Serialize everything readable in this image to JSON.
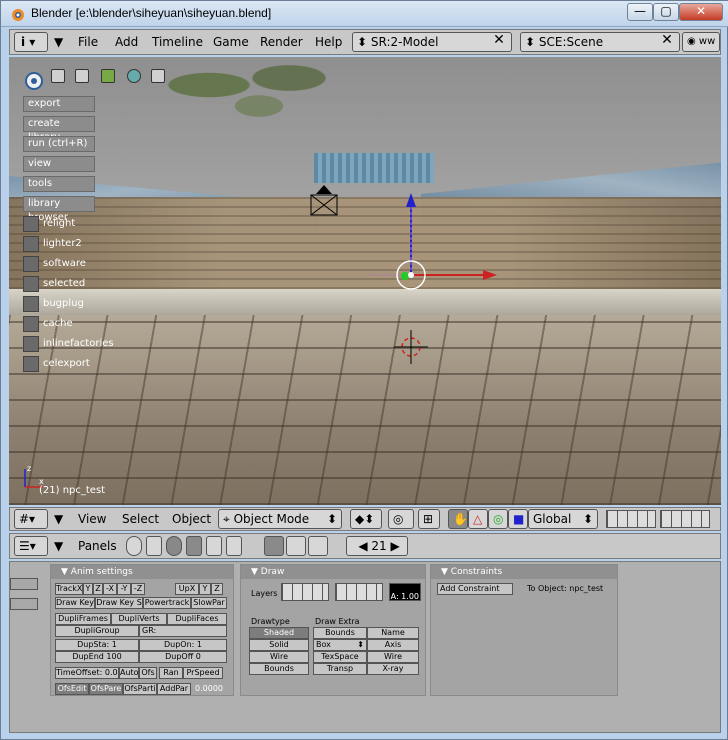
{
  "window": {
    "title": "Blender [e:\\blender\\siheyuan\\siheyuan.blend]"
  },
  "menubar": {
    "items": [
      "File",
      "Add",
      "Timeline",
      "Game",
      "Render",
      "Help"
    ],
    "screen": "SR:2-Model",
    "scene": "SCE:Scene",
    "extra": "ww"
  },
  "script_buttons": [
    "export",
    "create library",
    "run (ctrl+R)",
    "view",
    "tools",
    "library browser"
  ],
  "script_toggles": [
    "relight",
    "lighter2",
    "software",
    "selected",
    "bugplug",
    "cache",
    "inlinefactories",
    "celexport"
  ],
  "viewport": {
    "object_label": "(21) npc_test"
  },
  "view_header": {
    "menus": [
      "View",
      "Select",
      "Object"
    ],
    "mode": "Object Mode",
    "orientation": "Global"
  },
  "buttons_header": {
    "panels_label": "Panels",
    "frame": "21"
  },
  "anim_panel": {
    "title": "Anim settings",
    "row1": [
      "TrackX",
      "Y",
      "Z",
      "-X",
      "-Y",
      "-Z",
      "UpX",
      "Y",
      "Z"
    ],
    "row2": [
      "Draw Key",
      "Draw Key S",
      "Powertrack",
      "SlowPar"
    ],
    "row3": [
      "DupliFrames",
      "DupliVerts",
      "DupliFaces"
    ],
    "row4": [
      "DupliGroup",
      "GR:"
    ],
    "row5": [
      "DupSta: 1",
      "DupOn: 1"
    ],
    "row6": [
      "DupEnd 100",
      "DupOff 0"
    ],
    "row7": [
      "TimeOffset: 0.00",
      "Auto",
      "Ofs",
      "Ran",
      "PrSpeed"
    ],
    "row8": [
      "OfsEdit",
      "OfsPare",
      "OfsParti",
      "AddPar"
    ],
    "value": "0.0000"
  },
  "draw_panel": {
    "title": "Draw",
    "layers_label": "Layers",
    "alpha": "A: 1.00",
    "drawtype_label": "Drawtype",
    "drawextra_label": "Draw Extra",
    "drawtype": [
      "Shaded",
      "Solid",
      "Wire",
      "Bounds"
    ],
    "extra_left": [
      "Bounds",
      "Box",
      "TexSpace",
      "Transp"
    ],
    "extra_right": [
      "Name",
      "Axis",
      "Wire",
      "X-ray"
    ]
  },
  "constraints_panel": {
    "title": "Constraints",
    "add": "Add Constraint",
    "to_object": "To Object: npc_test"
  }
}
